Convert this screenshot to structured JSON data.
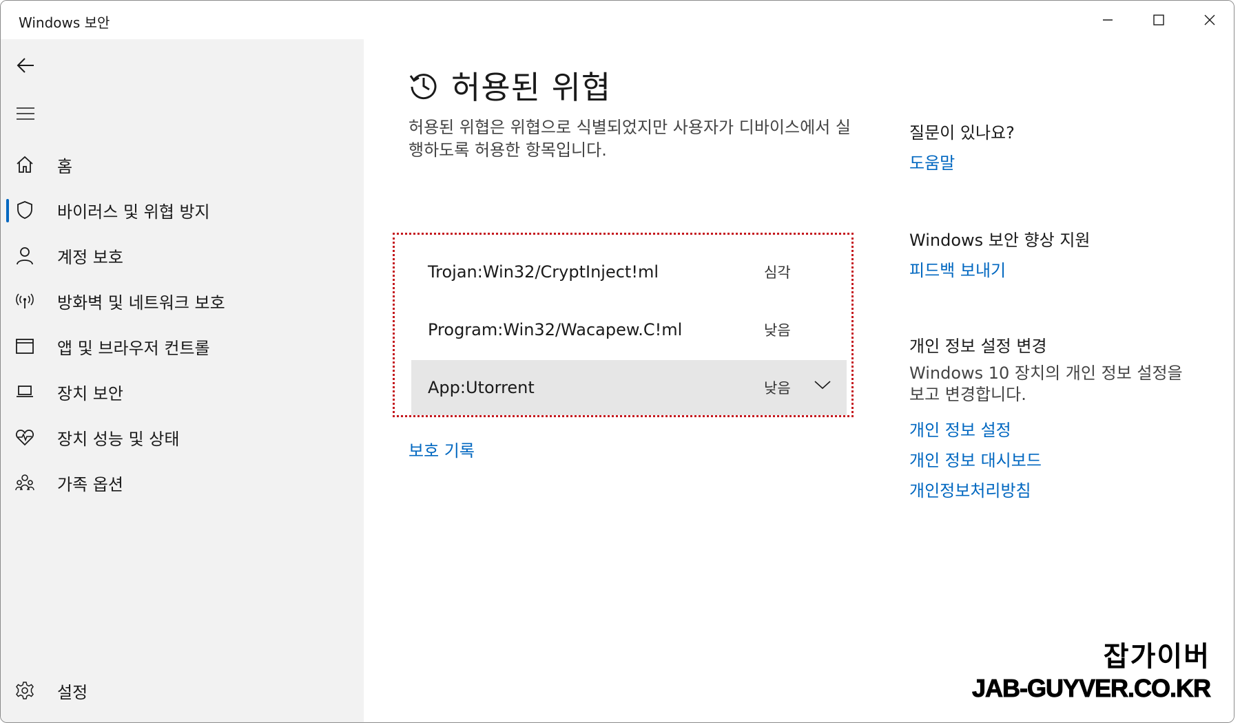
{
  "window": {
    "title": "Windows 보안"
  },
  "sidebar": {
    "items": [
      {
        "label": "홈",
        "icon": "home-icon"
      },
      {
        "label": "바이러스 및 위협 방지",
        "icon": "shield-icon",
        "active": true
      },
      {
        "label": "계정 보호",
        "icon": "person-icon"
      },
      {
        "label": "방화벽 및 네트워크 보호",
        "icon": "wireless-icon"
      },
      {
        "label": "앱 및 브라우저 컨트롤",
        "icon": "browser-window-icon"
      },
      {
        "label": "장치 보안",
        "icon": "laptop-icon"
      },
      {
        "label": "장치 성능 및 상태",
        "icon": "heart-pulse-icon"
      },
      {
        "label": "가족 옵션",
        "icon": "family-icon"
      }
    ],
    "settings_label": "설정"
  },
  "main": {
    "title": "허용된 위협",
    "description": "허용된 위협은 위협으로 식별되었지만 사용자가 디바이스에서 실행하도록 허용한 항목입니다.",
    "threats": [
      {
        "name": "Trojan:Win32/CryptInject!ml",
        "severity": "심각"
      },
      {
        "name": "Program:Win32/Wacapew.C!ml",
        "severity": "낮음"
      },
      {
        "name": "App:Utorrent",
        "severity": "낮음",
        "expanded": false,
        "selected": true
      }
    ],
    "history_link": "보호 기록"
  },
  "right": {
    "question_heading": "질문이 있나요?",
    "help_link": "도움말",
    "improve_heading": "Windows 보안 향상 지원",
    "feedback_link": "피드백 보내기",
    "privacy_heading": "개인 정보 설정 변경",
    "privacy_text": "Windows 10 장치의 개인 정보 설정을 보고 변경합니다.",
    "privacy_links": [
      "개인 정보 설정",
      "개인 정보 대시보드",
      "개인정보처리방침"
    ]
  },
  "watermark": {
    "korean": "잡가이버",
    "url": "JAB-GUYVER.CO.KR"
  },
  "colors": {
    "accent": "#0067c0",
    "sidebar_bg": "#f2f2f2",
    "highlight_border": "#c4161c",
    "selected_row": "#e6e6e6"
  }
}
